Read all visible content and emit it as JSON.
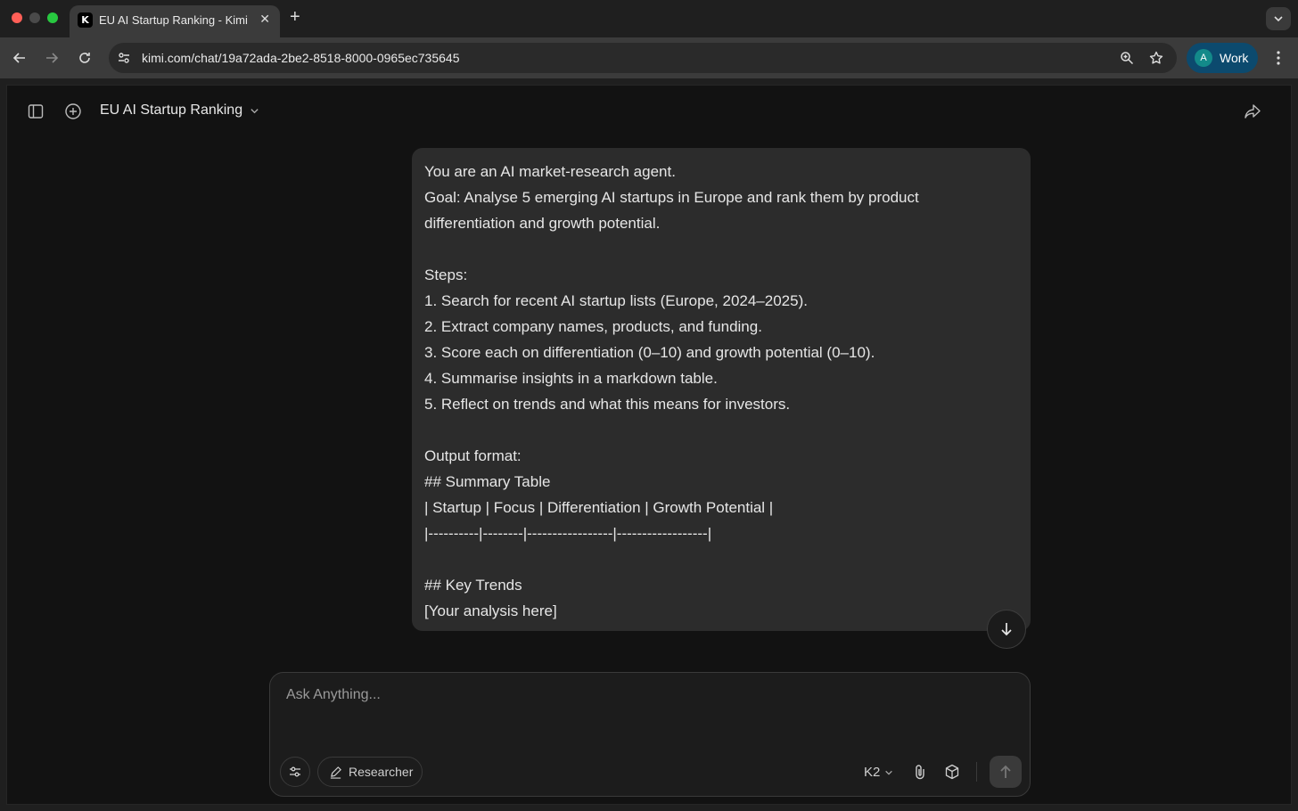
{
  "browser": {
    "tab_favicon": "K",
    "tab_title": "EU AI Startup Ranking - Kimi",
    "url": "kimi.com/chat/19a72ada-2be2-8518-8000-0965ec735645",
    "profile_initial": "A",
    "profile_label": "Work"
  },
  "header": {
    "chat_title": "EU AI Startup Ranking"
  },
  "message": {
    "lines": [
      "You are an AI market-research agent.",
      "Goal: Analyse 5 emerging AI startups in Europe and rank them by product",
      "differentiation and growth potential.",
      "",
      "Steps:",
      "1. Search for recent AI startup lists (Europe, 2024–2025).",
      "2. Extract company names, products, and funding.",
      "3. Score each on differentiation (0–10) and growth potential (0–10).",
      "4. Summarise insights in a markdown table.",
      "5. Reflect on trends and what this means for investors.",
      "",
      "Output format:",
      "## Summary Table",
      "| Startup | Focus | Differentiation | Growth Potential |",
      "|----------|--------|-----------------|------------------|",
      "",
      "## Key Trends",
      "[Your analysis here]"
    ]
  },
  "composer": {
    "placeholder": "Ask Anything...",
    "mode_label": "Researcher",
    "model_label": "K2"
  },
  "colors": {
    "page_bg": "#121212",
    "bubble_bg": "#2c2c2c",
    "profile_bg": "#0c4a6e",
    "avatar_bg": "#138a8a"
  }
}
